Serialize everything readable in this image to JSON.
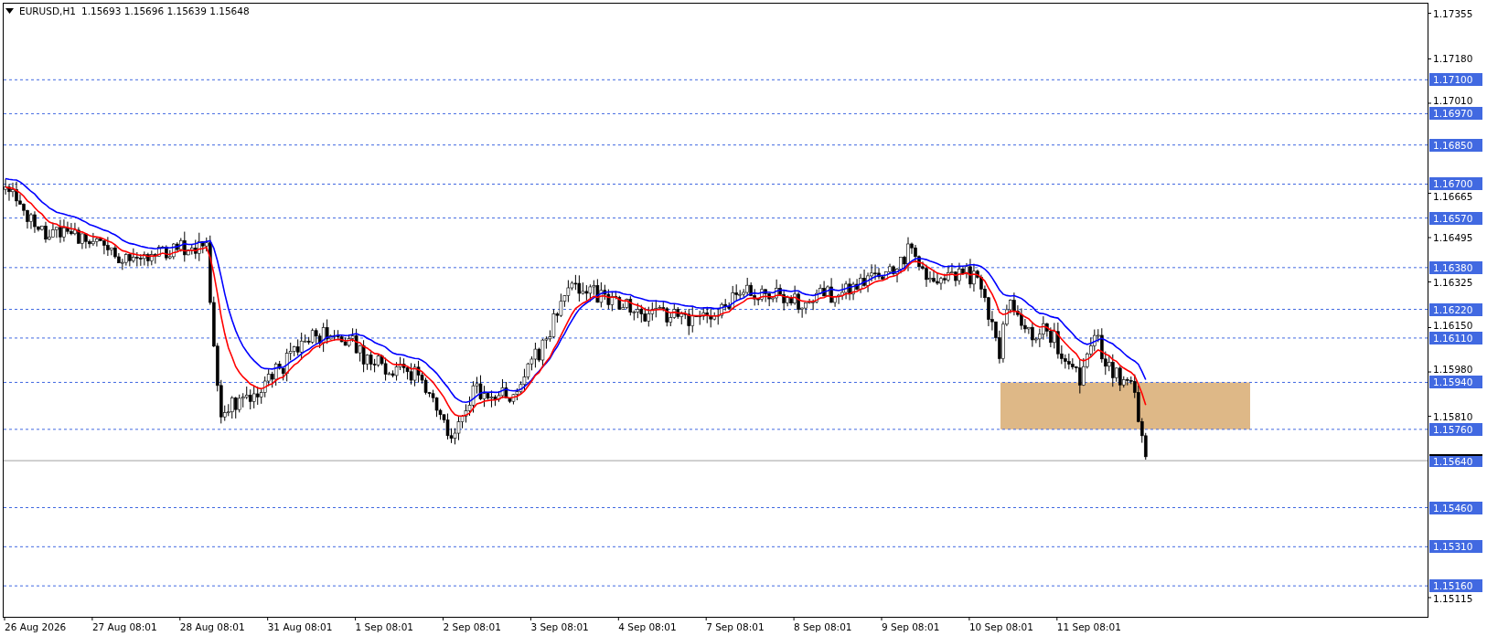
{
  "header": {
    "symbol": "EURUSD,H1",
    "ohlc": "1.15693 1.15696 1.15639 1.15648"
  },
  "price_axis": {
    "ticks": [
      "1.17355",
      "1.17180",
      "1.17010",
      "1.16665",
      "1.16495",
      "1.16325",
      "1.16150",
      "1.15980",
      "1.15810",
      "1.15115"
    ]
  },
  "levels": [
    {
      "price": "1.17100",
      "kind": "level"
    },
    {
      "price": "1.16970",
      "kind": "level"
    },
    {
      "price": "1.16850",
      "kind": "level"
    },
    {
      "price": "1.16700",
      "kind": "level"
    },
    {
      "price": "1.16570",
      "kind": "level"
    },
    {
      "price": "1.16380",
      "kind": "level"
    },
    {
      "price": "1.16220",
      "kind": "level"
    },
    {
      "price": "1.16110",
      "kind": "level"
    },
    {
      "price": "1.15940",
      "kind": "level"
    },
    {
      "price": "1.15760",
      "kind": "level"
    },
    {
      "price": "1.15640",
      "kind": "current"
    },
    {
      "price": "1.15460",
      "kind": "level"
    },
    {
      "price": "1.15310",
      "kind": "level"
    },
    {
      "price": "1.15160",
      "kind": "level"
    }
  ],
  "time_axis": [
    "26 Aug 2026",
    "27 Aug 08:01",
    "28 Aug 08:01",
    "31 Aug 08:01",
    "1 Sep 08:01",
    "2 Sep 08:01",
    "3 Sep 08:01",
    "4 Sep 08:01",
    "7 Sep 08:01",
    "8 Sep 08:01",
    "9 Sep 08:01",
    "10 Sep 08:01",
    "11 Sep 08:01"
  ]
}
